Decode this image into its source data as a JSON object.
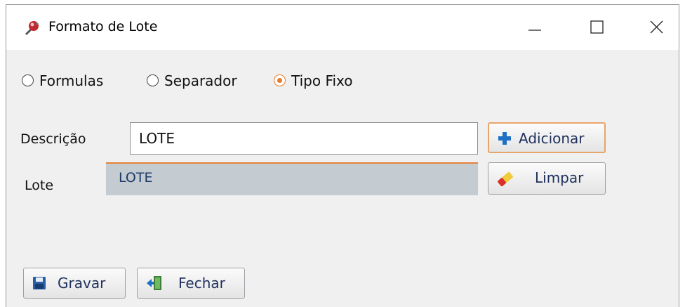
{
  "window": {
    "title": "Formato de Lote",
    "app_icon": "red-tool-app-icon",
    "controls": {
      "minimize": "minimize-icon",
      "maximize": "maximize-icon",
      "close": "close-icon"
    }
  },
  "radios": [
    {
      "label": "Formulas",
      "checked": false
    },
    {
      "label": "Separador",
      "checked": false
    },
    {
      "label": "Tipo Fixo",
      "checked": true
    }
  ],
  "form": {
    "descricao_label": "Descrição",
    "descricao_value": "LOTE",
    "lote_label": "Lote",
    "lote_value": "LOTE"
  },
  "buttons": {
    "adicionar": "Adicionar",
    "limpar": "Limpar",
    "gravar": "Gravar",
    "fechar": "Fechar"
  },
  "colors": {
    "accent": "#ea7a2a",
    "lote_background": "#c4cbd1",
    "button_text": "#1d2f5c"
  }
}
